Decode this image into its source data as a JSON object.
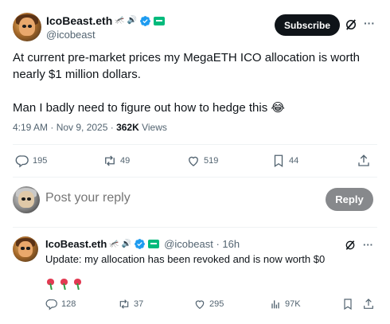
{
  "main_tweet": {
    "display_name": "IcoBeast.eth",
    "handle": "@icobeast",
    "subscribe_label": "Subscribe",
    "text_lines": [
      "At current pre-market prices my MegaETH ICO allocation is worth nearly $1 million dollars.",
      "Man I badly need to figure out how to hedge this 😂"
    ],
    "timestamp": "4:19 AM · Nov 9, 2025 · ",
    "views_count": "362K",
    "views_label": " Views",
    "actions": {
      "replies": "195",
      "reposts": "49",
      "likes": "519",
      "bookmarks": "44"
    }
  },
  "reply_composer": {
    "placeholder": "Post your reply",
    "button_label": "Reply"
  },
  "reply_tweet": {
    "display_name": "IcoBeast.eth",
    "handle_time": "@icobeast · 16h",
    "text": "Update: my allocation has been revoked and is now worth $0",
    "actions": {
      "replies": "128",
      "reposts": "37",
      "likes": "295",
      "views": "97K"
    }
  },
  "colors": {
    "text_primary": "#0f1419",
    "text_secondary": "#536471",
    "verified_blue": "#1d9bf0",
    "affiliate_green": "#00ba7c",
    "reply_button_bg": "#87898c"
  },
  "icons": [
    "verified-badge-icon",
    "grok-icon",
    "more-icon",
    "reply-icon",
    "repost-icon",
    "like-icon",
    "bookmark-icon",
    "share-icon",
    "views-icon",
    "rose-icon"
  ]
}
